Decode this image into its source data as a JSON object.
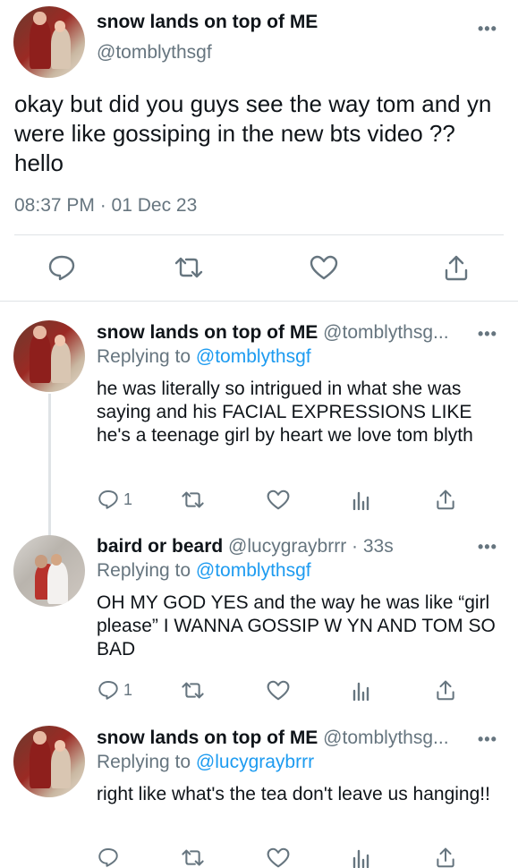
{
  "main_tweet": {
    "name": "snow lands on top of ME",
    "handle": "@tomblythsgf",
    "text": "okay but did you guys see the way tom and yn were like gossiping in the new bts video ?? hello",
    "timestamp": "08:37 PM · 01 Dec 23",
    "more": "•••",
    "actions": [
      "reply-icon",
      "retweet-icon",
      "like-icon",
      "share-icon"
    ]
  },
  "replies": [
    {
      "name": "snow lands on top of ME",
      "handle_time": "@tomblythsg...",
      "replying_prefix": "Replying to",
      "replying_to": "@tomblythsgf",
      "text": "he was literally so intrigued in what she was saying and his FACIAL EXPRESSIONS LIKE he's a teenage girl by heart we love tom blyth",
      "reply_count": "1",
      "more": "•••"
    },
    {
      "name": "baird or beard",
      "handle_time": "@lucygraybrrr · 33s",
      "replying_prefix": "Replying to",
      "replying_to": "@tomblythsgf",
      "text": "OH MY GOD YES and the way he was like “girl please” I WANNA GOSSIP W YN AND TOM SO BAD",
      "reply_count": "1",
      "more": "•••"
    },
    {
      "name": "snow lands on top of ME",
      "handle_time": "@tomblythsg...",
      "replying_prefix": "Replying to",
      "replying_to": "@lucygraybrrr",
      "text": "right like what's the tea don't leave us hanging!!",
      "more": "•••"
    }
  ],
  "colors": {
    "accent": "#1d9bf0",
    "muted": "#66757f",
    "divider": "#dfe3e6"
  }
}
